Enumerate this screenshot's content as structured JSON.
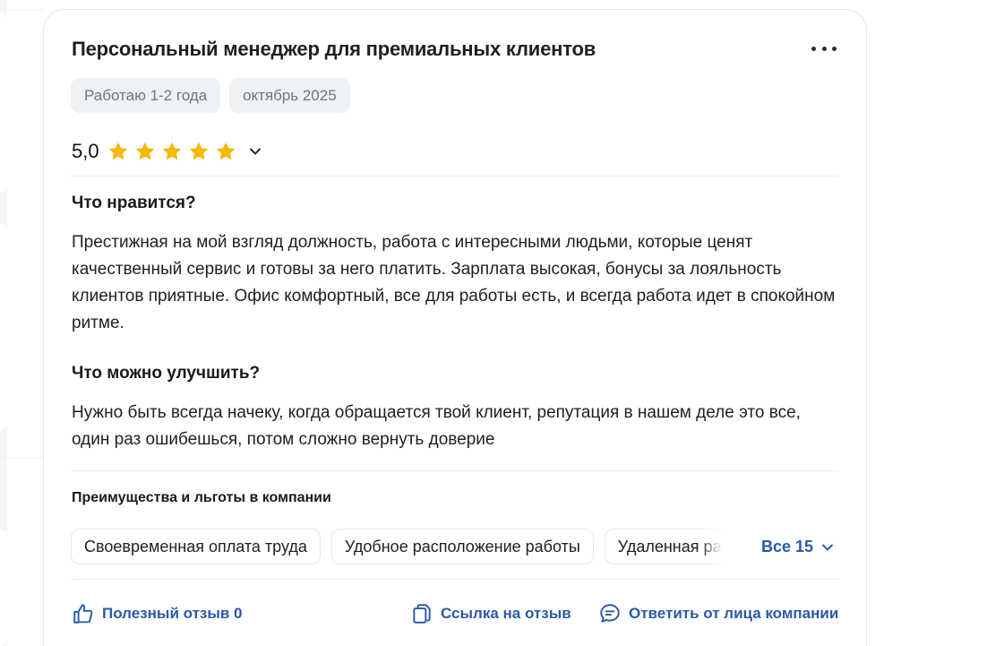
{
  "review": {
    "title": "Персональный менеджер для премиальных клиентов",
    "tags": [
      "Работаю 1-2 года",
      "октябрь 2025"
    ],
    "rating": {
      "value": "5,0",
      "stars": 5,
      "max": 5
    },
    "likes_label": "Что нравится?",
    "likes_text": "Престижная на мой взгляд должность, работа с интересными людьми, которые ценят качественный сервис и готовы за него платить. Зарплата высокая, бонусы за лояльность клиентов приятные. Офис комфортный, все для работы есть, и всегда работа идет в спокойном ритме.",
    "improve_label": "Что можно улучшить?",
    "improve_text": "Нужно быть всегда начеку, когда обращается твой клиент, репутация в нашем деле это все, один раз ошибешься, потом сложно вернуть доверие"
  },
  "benefits": {
    "title": "Преимущества и льготы в компании",
    "chips": [
      "Своевременная оплата труда",
      "Удобное расположение работы",
      "Удаленная работа"
    ],
    "all_label": "Все 15"
  },
  "actions": {
    "useful": "Полезный отзыв 0",
    "link": "Ссылка на отзыв",
    "reply": "Ответить от лица компании"
  },
  "colors": {
    "accent": "#2b5aa6",
    "star": "#f5b900",
    "tag_bg": "#eef1f6"
  },
  "icons": {
    "more": "more-dots-icon",
    "star": "star-icon",
    "chevron": "chevron-down-icon",
    "thumb": "thumbs-up-icon",
    "copy": "copy-link-icon",
    "chat": "chat-icon"
  }
}
